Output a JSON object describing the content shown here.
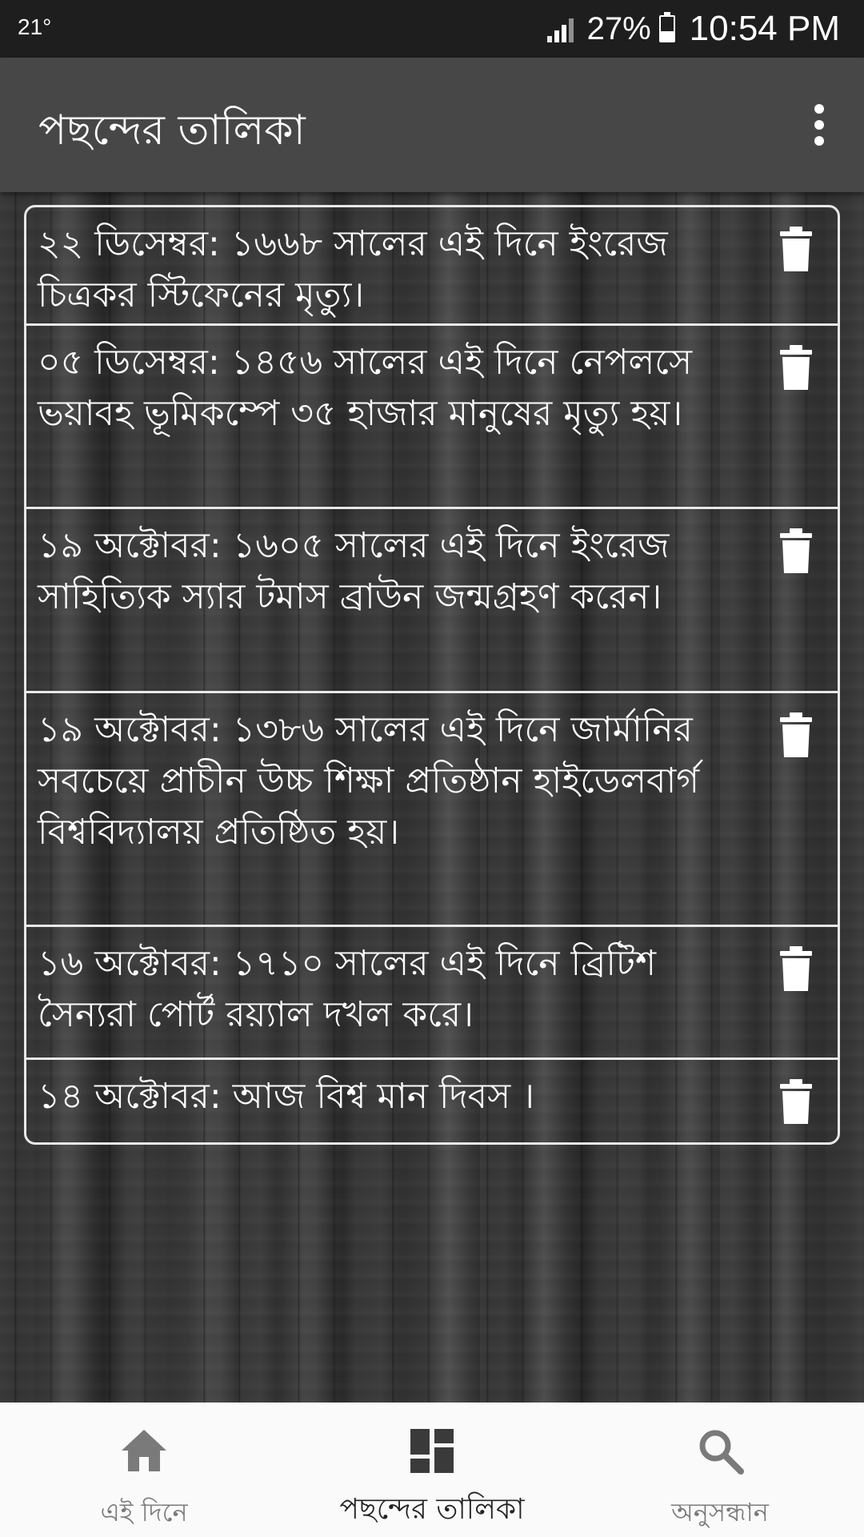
{
  "status_bar": {
    "temperature": "21°",
    "battery": "27%",
    "time": "10:54 PM"
  },
  "app_bar": {
    "title": "পছন্দের তালিকা",
    "menu_icon": "more-vert-icon"
  },
  "favorites": [
    {
      "text": "২২ ডিসেম্বর: ১৬৬৮ সালের এই দিনে ইংরেজ চিত্রকর স্টিফেনের মৃত্যু।",
      "delete_icon": "trash-icon"
    },
    {
      "text": "০৫ ডিসেম্বর: ১৪৫৬ সালের এই দিনে নেপলসে ভয়াবহ ভূমিকম্পে ৩৫ হাজার মানুষের মৃত্যু হয়।",
      "delete_icon": "trash-icon"
    },
    {
      "text": "১৯ অক্টোবর: ১৬০৫ সালের এই দিনে ইংরেজ সাহিত্যিক স্যার টমাস ব্রাউন জন্মগ্রহণ করেন।",
      "delete_icon": "trash-icon"
    },
    {
      "text": "১৯ অক্টোবর: ১৩৮৬ সালের এই দিনে জার্মানির সবচেয়ে প্রাচীন উচ্চ শিক্ষা প্রতিষ্ঠান হাইডেলবার্গ বিশ্ববিদ্যালয় প্রতিষ্ঠিত হয়।",
      "delete_icon": "trash-icon"
    },
    {
      "text": "১৬ অক্টোবর: ১৭১০ সালের এই দিনে ব্রিটিশ সৈন্যরা পোর্ট রয়্যাল দখল করে।",
      "delete_icon": "trash-icon"
    },
    {
      "text": "১৪ অক্টোবর: আজ বিশ্ব মান দিবস ।",
      "delete_icon": "trash-icon"
    }
  ],
  "bottom_nav": {
    "items": [
      {
        "label": "এই দিনে",
        "icon": "home-icon",
        "active": false
      },
      {
        "label": "পছন্দের তালিকা",
        "icon": "dashboard-icon",
        "active": true
      },
      {
        "label": "অনুসন্ধান",
        "icon": "search-icon",
        "active": false
      }
    ]
  },
  "colors": {
    "status_bar": "#1e1e1e",
    "app_bar": "#474747",
    "list_border": "#e8e8e8",
    "bottom_nav": "#fafafa",
    "nav_active": "#222222",
    "nav_inactive": "#7a7a7a"
  }
}
